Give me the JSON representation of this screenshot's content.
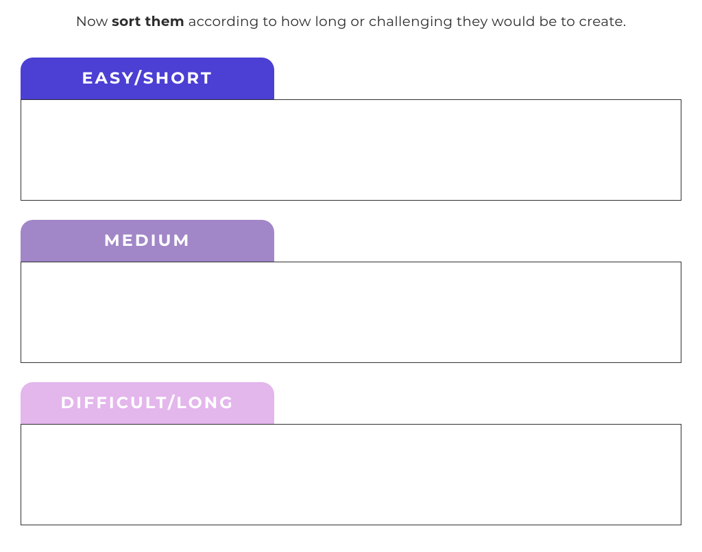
{
  "instruction": {
    "prefix": "Now ",
    "bold": "sort them",
    "suffix": " according to how long or challenging they would be to create."
  },
  "categories": [
    {
      "label": "EASY/SHORT",
      "color": "#4b3fd4"
    },
    {
      "label": "MEDIUM",
      "color": "#a186c8"
    },
    {
      "label": "DIFFICULT/LONG",
      "color": "#e3b6ec"
    }
  ]
}
